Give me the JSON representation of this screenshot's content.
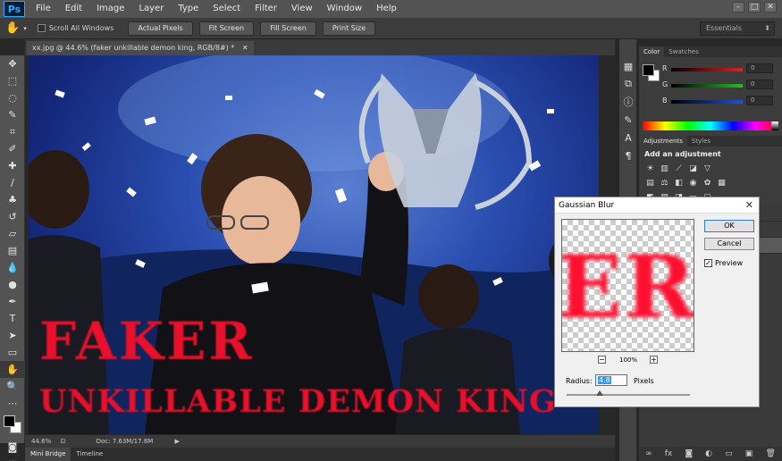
{
  "app": {
    "logo": "Ps"
  },
  "menu": [
    "File",
    "Edit",
    "Image",
    "Layer",
    "Type",
    "Select",
    "Filter",
    "View",
    "Window",
    "Help"
  ],
  "window_controls": [
    "–",
    "□",
    "✕"
  ],
  "options_bar": {
    "scroll_all_windows": "Scroll All Windows",
    "buttons": [
      "Actual Pixels",
      "Fit Screen",
      "Fill Screen",
      "Print Size"
    ],
    "workspace": "Essentials"
  },
  "document": {
    "tab_title": "xx.jpg @ 44.6% (faker unkillable demon king, RGB/8#) *",
    "close": "✕"
  },
  "canvas": {
    "text_line1": "FAKER",
    "text_line2": "UNKILLABLE DEMON KING"
  },
  "status": {
    "zoom": "44.6%",
    "doc": "Doc: 7.63M/17.8M"
  },
  "bottom_tabs": [
    "Mini Bridge",
    "Timeline"
  ],
  "color_panel": {
    "tabs": [
      "Color",
      "Swatches"
    ],
    "channels": [
      {
        "letter": "R",
        "value": "0",
        "color": "#e02020"
      },
      {
        "letter": "G",
        "value": "0",
        "color": "#20c020"
      },
      {
        "letter": "B",
        "value": "0",
        "color": "#2050e0"
      }
    ]
  },
  "adjustments_panel": {
    "tabs": [
      "Adjustments",
      "Styles"
    ],
    "title": "Add an adjustment"
  },
  "dialog": {
    "title": "Gaussian Blur",
    "close": "✕",
    "ok": "OK",
    "cancel": "Cancel",
    "preview_label": "Preview",
    "preview_checked": true,
    "preview_sample": "ER",
    "zoom_out": "−",
    "zoom_in": "+",
    "zoom": "100%",
    "radius_label": "Radius:",
    "radius_value": "4.8",
    "radius_unit": "Pixels",
    "radius_fraction": 0.27
  }
}
